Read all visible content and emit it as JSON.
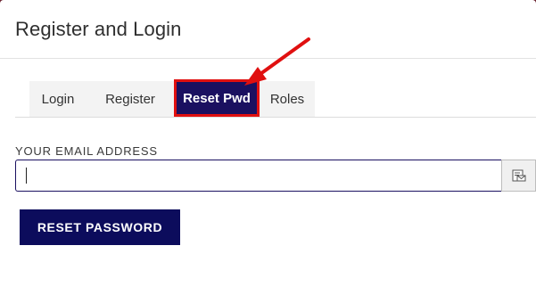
{
  "modal": {
    "title": "Register and Login"
  },
  "tabs": [
    {
      "label": "Login",
      "active": false
    },
    {
      "label": "Register",
      "active": false
    },
    {
      "label": "Reset Pwd",
      "active": true
    },
    {
      "label": "Roles",
      "active": false
    }
  ],
  "form": {
    "email_label": "YOUR EMAIL ADDRESS",
    "email_value": "",
    "email_placeholder": "",
    "submit_label": "RESET PASSWORD"
  },
  "icons": {
    "input_addon": "email-card-icon",
    "annotation": "red-arrow-icon"
  },
  "colors": {
    "active_tab": "#1a1060",
    "button": "#0c0c5c",
    "highlight": "#e01010"
  }
}
